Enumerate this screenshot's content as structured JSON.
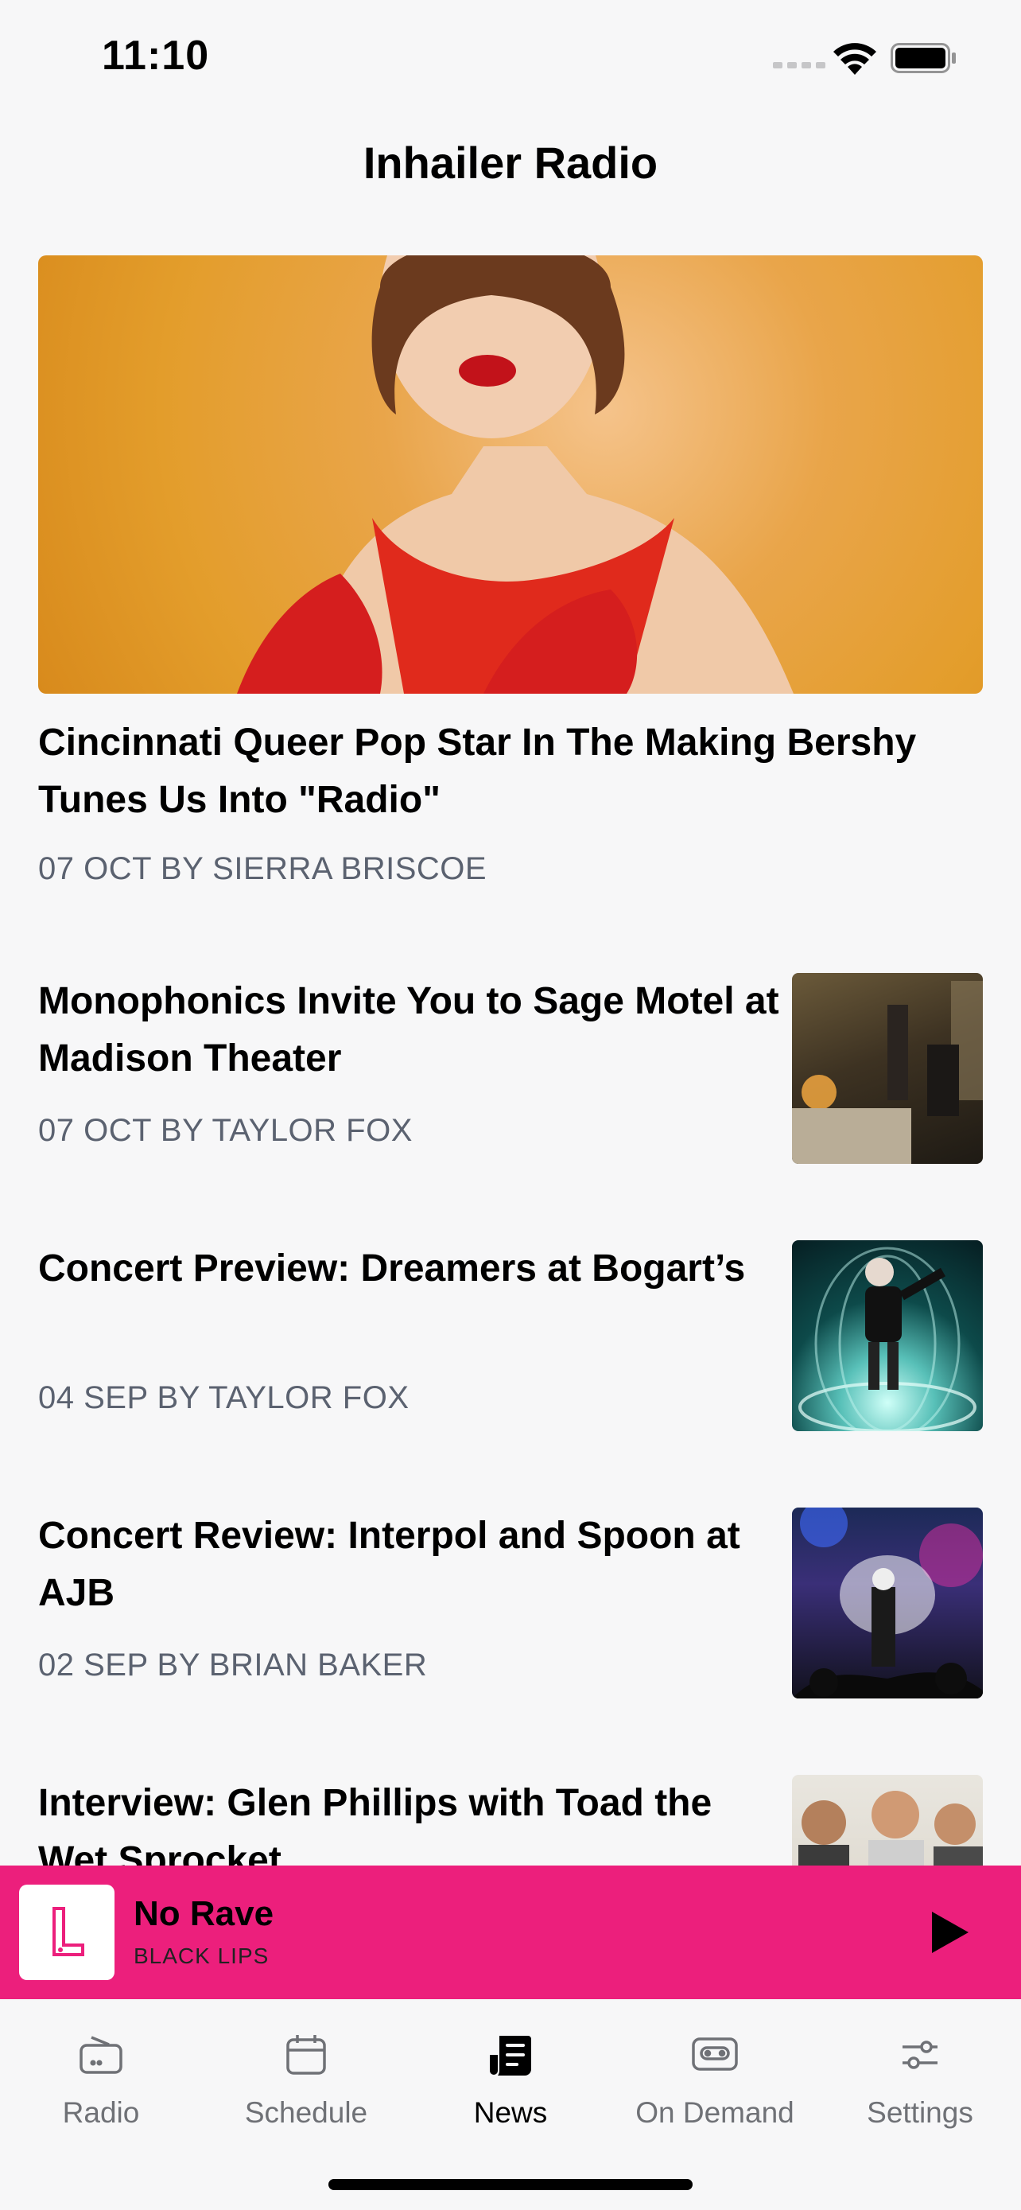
{
  "status_bar": {
    "time": "11:10"
  },
  "header": {
    "title": "Inhailer Radio"
  },
  "featured": {
    "title": "Cincinnati Queer Pop Star In The Making Bershy Tunes Us Into \"Radio\"",
    "meta": "07 OCT BY SIERRA BRISCOE"
  },
  "articles": [
    {
      "title": "Monophonics Invite You to Sage Motel at Madison Theater",
      "meta": "07 OCT BY TAYLOR FOX"
    },
    {
      "title": "Concert Preview: Dreamers at Bogart’s",
      "meta": "04 SEP BY TAYLOR FOX"
    },
    {
      "title": "Concert Review: Interpol and Spoon at AJB",
      "meta": "02 SEP BY BRIAN BAKER"
    },
    {
      "title": "Interview: Glen Phillips with Toad the Wet Sprocket",
      "meta": ""
    }
  ],
  "player": {
    "track": "No Rave",
    "artist": "BLACK LIPS"
  },
  "tabs": [
    {
      "label": "Radio",
      "icon": "radio-icon"
    },
    {
      "label": "Schedule",
      "icon": "calendar-icon"
    },
    {
      "label": "News",
      "icon": "news-icon"
    },
    {
      "label": "On Demand",
      "icon": "cassette-icon"
    },
    {
      "label": "Settings",
      "icon": "sliders-icon"
    }
  ],
  "colors": {
    "accent": "#ec1f7c",
    "meta_text": "#5b6270",
    "background": "#f7f7f8"
  }
}
